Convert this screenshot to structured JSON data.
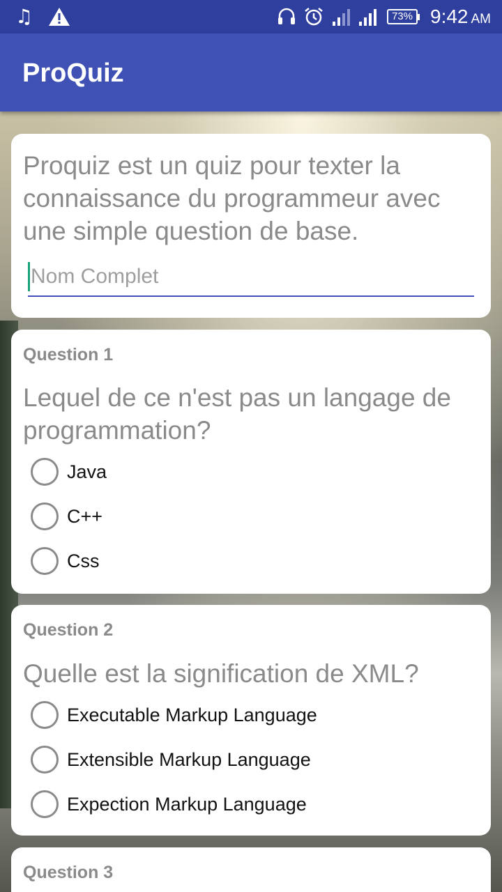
{
  "status_bar": {
    "icons_left": [
      "music-icon",
      "warning-icon"
    ],
    "icons_right": [
      "headset-icon",
      "alarm-icon",
      "signal-icon",
      "signal-icon"
    ],
    "battery": "73%",
    "time": "9:42",
    "ampm": "AM"
  },
  "app_bar": {
    "title": "ProQuiz"
  },
  "intro": {
    "text": "Proquiz est un quiz pour texter la connaissance du programmeur avec une simple question de base.",
    "name_placeholder": "Nom Complet",
    "name_value": ""
  },
  "questions": [
    {
      "label": "Question 1",
      "text": "Lequel de ce n'est pas un langage de programmation?",
      "options": [
        "Java",
        "C++",
        "Css"
      ]
    },
    {
      "label": "Question 2",
      "text": "Quelle est la signification de XML?",
      "options": [
        "Executable Markup Language",
        "Extensible Markup Language",
        "Expection Markup Language"
      ]
    },
    {
      "label": "Question 3"
    }
  ],
  "colors": {
    "status_bar": "#2f3f9e",
    "app_bar": "#3f51b5",
    "accent": "#1aa37a",
    "secondary_text": "#8a8a8a"
  }
}
